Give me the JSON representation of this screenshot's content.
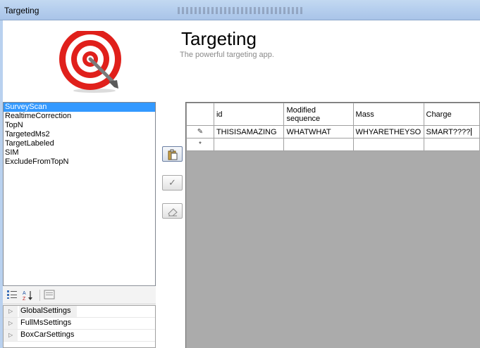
{
  "window": {
    "title": "Targeting"
  },
  "header": {
    "title": "Targeting",
    "subtitle": "The powerful targeting app."
  },
  "mode_list": {
    "items": [
      "SurveyScan",
      "RealtimeCorrection",
      "TopN",
      "TargetedMs2",
      "TargetLabeled",
      "SIM",
      "ExcludeFromTopN"
    ],
    "selected": "SurveyScan"
  },
  "property_grid": {
    "toolbar": {
      "categorized_icon": "categorized-icon",
      "alphabetical_icon": "sort-az-icon",
      "pages_icon": "property-pages-icon"
    },
    "rows": [
      "GlobalSettings",
      "FullMsSettings",
      "BoxCarSettings"
    ]
  },
  "side_buttons": {
    "paste_icon": "paste-icon",
    "apply_icon": "checkmark-icon",
    "clear_icon": "eraser-icon"
  },
  "grid": {
    "columns": [
      "id",
      "Modified sequence",
      "Mass",
      "Charge"
    ],
    "rows": [
      {
        "marker": "✎",
        "cells": [
          "THISISAMAZING",
          "WHATWHAT",
          "WHYARETHEYSO",
          "SMART????"
        ]
      },
      {
        "marker": "*",
        "cells": [
          "",
          "",
          "",
          ""
        ]
      }
    ]
  },
  "colors": {
    "selection": "#3399ff",
    "target_red": "#e0201b",
    "title_bar": "#b6cfee"
  }
}
